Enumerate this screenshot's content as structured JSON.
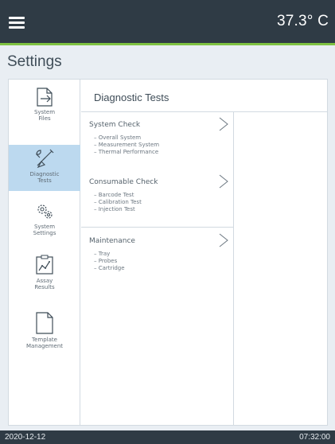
{
  "header": {
    "menu_icon": "hamburger-menu-icon",
    "temperature": "37.3° C"
  },
  "colors": {
    "topbar": "#2f3b45",
    "accent": "#7fc241",
    "active_item": "#bcd9ef",
    "background": "#e9eef3"
  },
  "page": {
    "title": "Settings"
  },
  "sidebar": {
    "items": [
      {
        "label": "System\nFiles",
        "icon": "file-export-icon",
        "active": false
      },
      {
        "label": "Diagnostic\nTests",
        "icon": "tools-icon",
        "active": true
      },
      {
        "label": "System\nSettings",
        "icon": "gears-icon",
        "active": false
      },
      {
        "label": "Assay\nResults",
        "icon": "chart-clipboard-icon",
        "active": false
      },
      {
        "label": "Template\nManagement",
        "icon": "document-icon",
        "active": false
      }
    ]
  },
  "main": {
    "title": "Diagnostic Tests",
    "groups": [
      {
        "title": "System Check",
        "items": [
          "– Overall System",
          "– Measurement System",
          "– Thermal Performance"
        ]
      },
      {
        "title": "Consumable Check",
        "items": [
          "– Barcode Test",
          "– Calibration Test",
          "– Injection Test"
        ]
      },
      {
        "title": "Maintenance",
        "items": [
          "– Tray",
          "– Probes",
          "– Cartridge"
        ]
      }
    ]
  },
  "status": {
    "date": "2020-12-12",
    "time": "07:32:00"
  }
}
